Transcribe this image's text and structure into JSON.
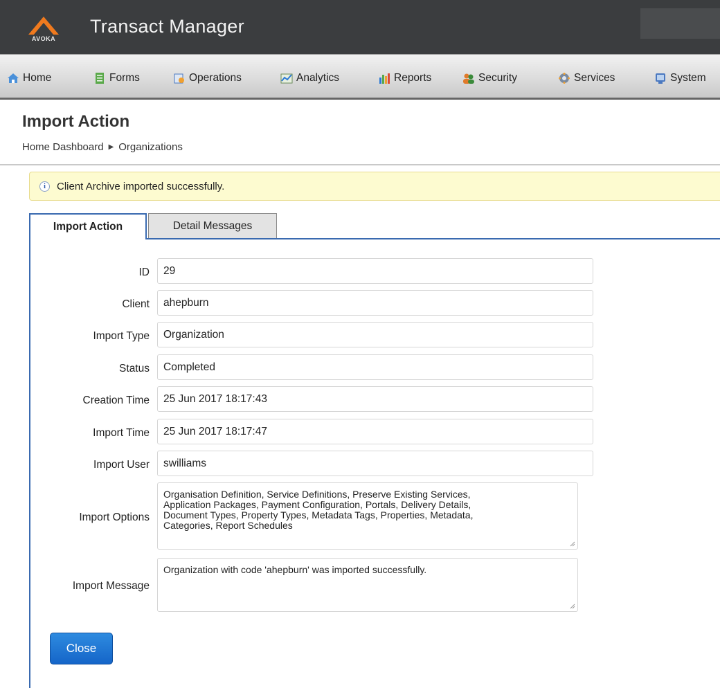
{
  "header": {
    "logo_text": "AVOKA",
    "app_title": "Transact Manager"
  },
  "nav": {
    "items": [
      {
        "label": "Home",
        "icon": "home-icon"
      },
      {
        "label": "Forms",
        "icon": "forms-icon"
      },
      {
        "label": "Operations",
        "icon": "operations-icon"
      },
      {
        "label": "Analytics",
        "icon": "analytics-icon"
      },
      {
        "label": "Reports",
        "icon": "reports-icon"
      },
      {
        "label": "Security",
        "icon": "security-icon"
      },
      {
        "label": "Services",
        "icon": "services-icon"
      },
      {
        "label": "System",
        "icon": "system-icon"
      }
    ]
  },
  "page": {
    "title": "Import Action",
    "breadcrumb": [
      "Home Dashboard",
      "Organizations"
    ]
  },
  "alert": {
    "message": "Client Archive imported successfully."
  },
  "tabs": [
    {
      "label": "Import Action",
      "active": true
    },
    {
      "label": "Detail Messages",
      "active": false
    }
  ],
  "form": {
    "fields": [
      {
        "label": "ID",
        "value": "29"
      },
      {
        "label": "Client",
        "value": "ahepburn"
      },
      {
        "label": "Import Type",
        "value": "Organization"
      },
      {
        "label": "Status",
        "value": "Completed"
      },
      {
        "label": "Creation Time",
        "value": "25 Jun 2017 18:17:43"
      },
      {
        "label": "Import Time",
        "value": "25 Jun 2017 18:17:47"
      },
      {
        "label": "Import User",
        "value": "swilliams"
      }
    ],
    "import_options": {
      "label": "Import Options",
      "lines": [
        "Organisation Definition, Service Definitions, Preserve Existing Services,",
        "Application Packages, Payment Configuration, Portals, Delivery Details,",
        "Document Types, Property Types, Metadata Tags, Properties, Metadata,",
        "Categories, Report Schedules"
      ]
    },
    "import_message": {
      "label": "Import Message",
      "value": "Organization with code 'ahepburn' was imported successfully."
    }
  },
  "buttons": {
    "close_label": "Close"
  },
  "colors": {
    "header_bg": "#3b3d3f",
    "accent": "#3a6ab0",
    "button": "#1f77d6",
    "alert_bg": "#fdfbd0",
    "logo_orange": "#f07a1e"
  }
}
